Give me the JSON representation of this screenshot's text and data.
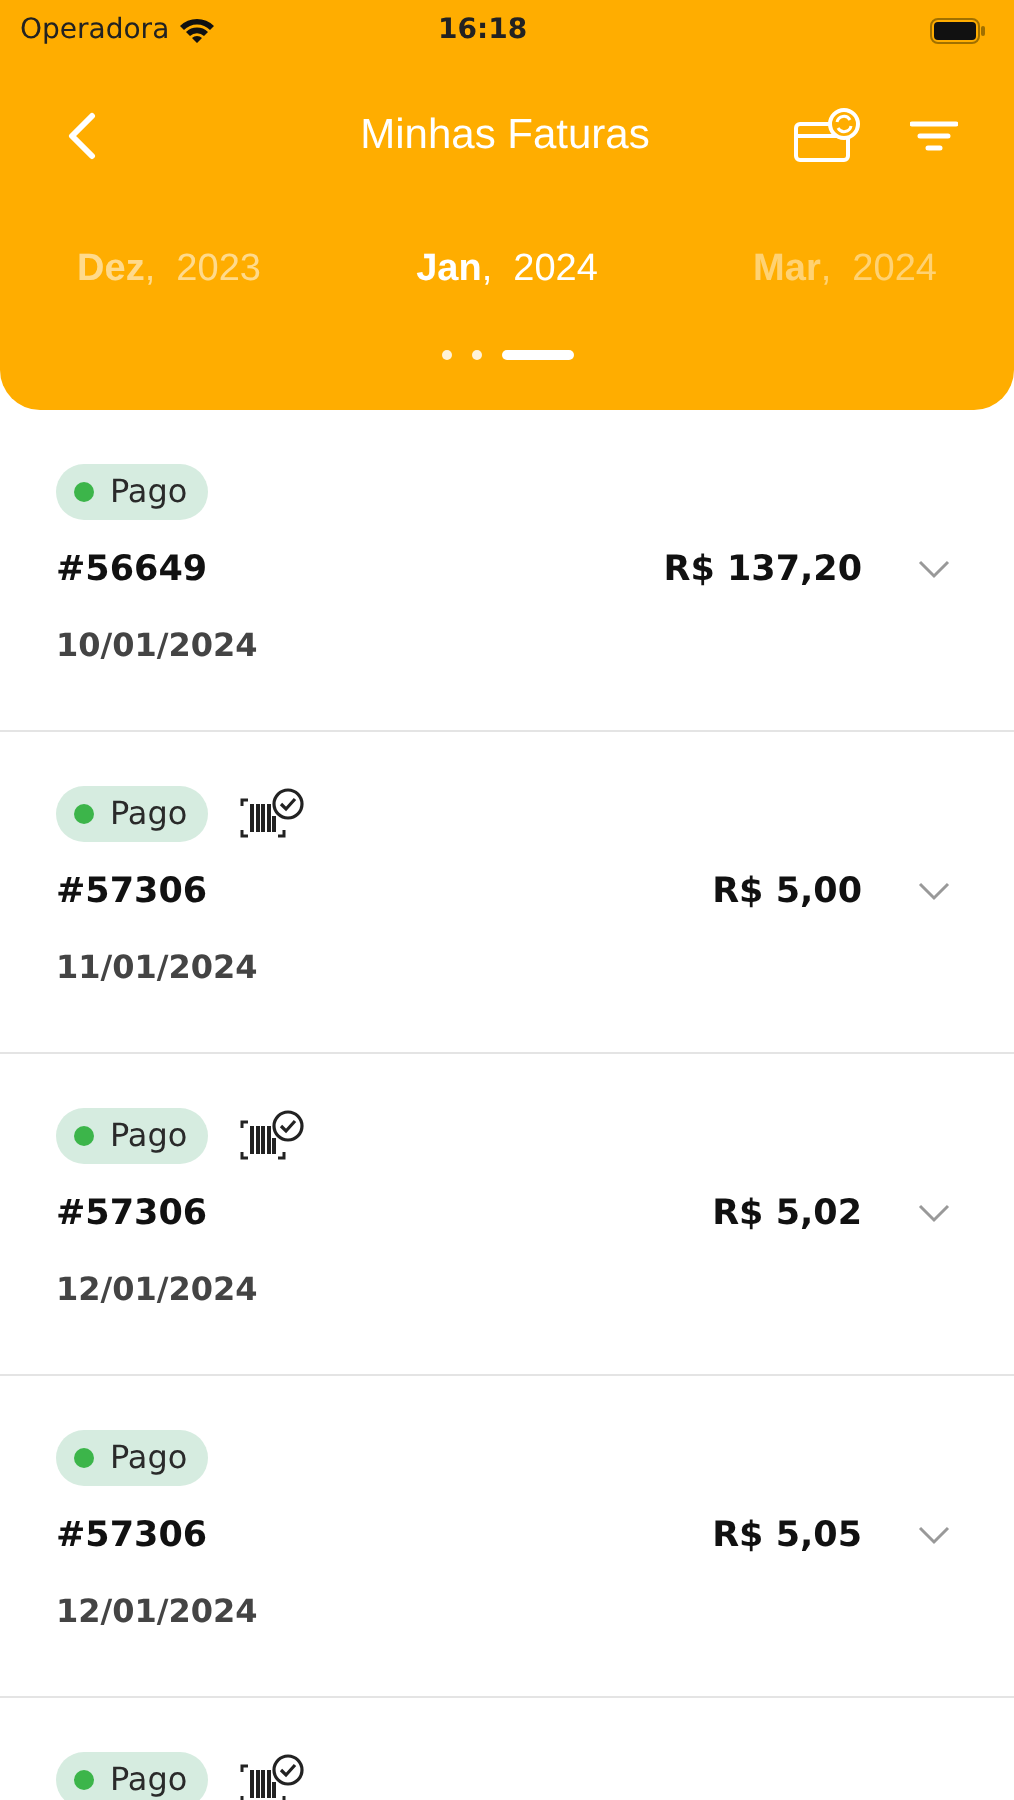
{
  "status_bar": {
    "carrier": "Operadora",
    "time": "16:18"
  },
  "header": {
    "title": "Minhas Faturas"
  },
  "months": [
    {
      "label": "**Dez**,  2023",
      "selected": false
    },
    {
      "label": "**Jan**,  2024",
      "selected": true
    },
    {
      "label": "**Mar**,  2024",
      "selected": false
    }
  ],
  "pager": [
    {
      "selected": false
    },
    {
      "selected": false
    },
    {
      "selected": true
    }
  ],
  "invoices": [
    {
      "status": "Pago",
      "color": "#3cb54a",
      "barcode_paid": false,
      "number": "#56649",
      "amount": "R$ 137,20",
      "date": "10/01/2024"
    },
    {
      "status": "Pago",
      "color": "#3cb54a",
      "barcode_paid": true,
      "number": "#57306",
      "amount": "R$ 5,00",
      "date": "11/01/2024"
    },
    {
      "status": "Pago",
      "color": "#3cb54a",
      "barcode_paid": true,
      "number": "#57306",
      "amount": "R$ 5,02",
      "date": "12/01/2024"
    },
    {
      "status": "Pago",
      "color": "#3cb54a",
      "barcode_paid": false,
      "number": "#57306",
      "amount": "R$ 5,05",
      "date": "12/01/2024"
    },
    {
      "status": "Pago",
      "color": "#3cb54a",
      "barcode_paid": true
    }
  ]
}
